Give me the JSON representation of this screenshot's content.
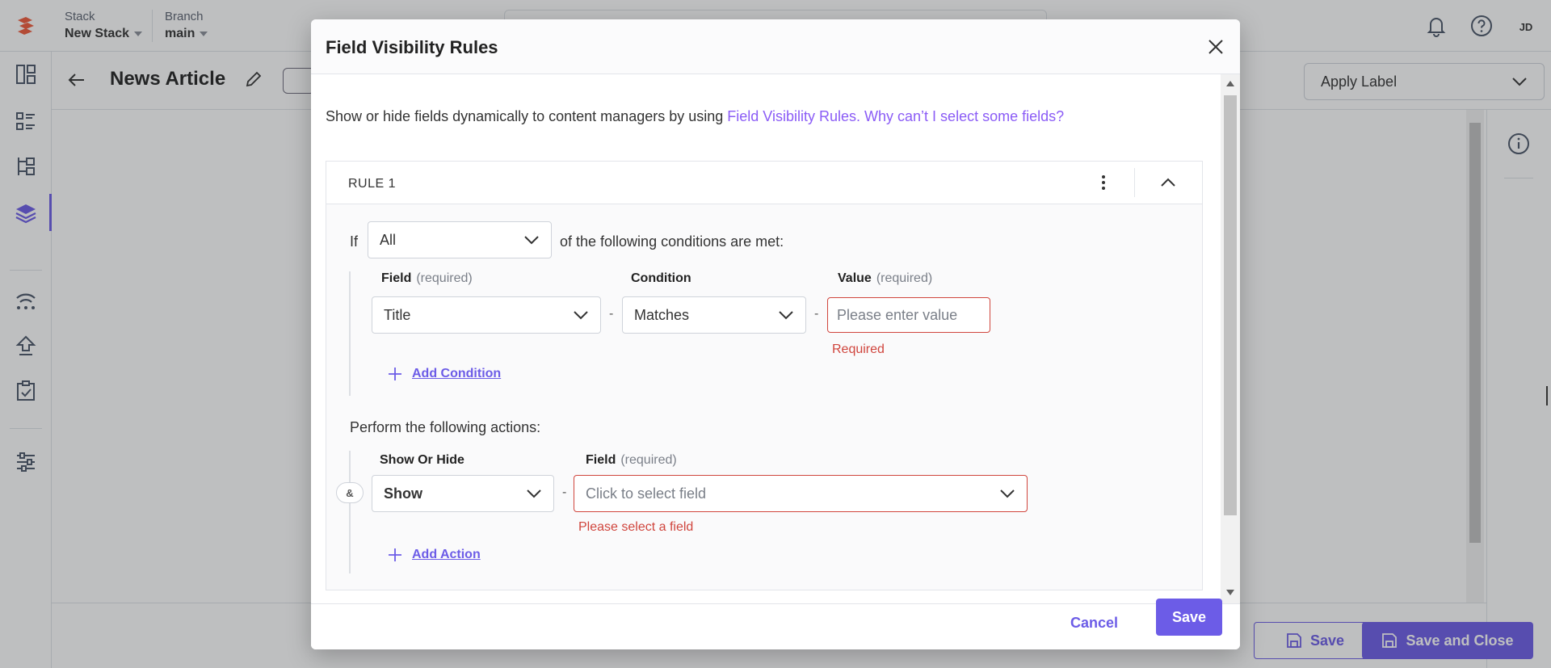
{
  "topbar": {
    "stack_label": "Stack",
    "stack_value": "New Stack",
    "branch_label": "Branch",
    "branch_value": "main",
    "avatar_initials": "JD"
  },
  "entry": {
    "title": "News Article",
    "apply_label": "Apply Label"
  },
  "bottom": {
    "save_label": "Save",
    "save_close_label": "Save and Close"
  },
  "modal": {
    "title": "Field Visibility Rules",
    "intro_text": "Show or hide fields dynamically to content managers by using ",
    "intro_link1": "Field Visibility Rules.",
    "intro_link2": "Why can’t I select some fields?",
    "rule": {
      "name": "RULE 1",
      "if_label": "If",
      "match_value": "All",
      "match_suffix": "of the following conditions are met:",
      "conditions": {
        "field_label": "Field",
        "field_req": "(required)",
        "condition_label": "Condition",
        "value_label": "Value",
        "value_req": "(required)",
        "field_value": "Title",
        "condition_value": "Matches",
        "value_placeholder": "Please enter value",
        "value_error": "Required",
        "add_condition": "Add Condition"
      },
      "actions_heading": "Perform the following actions:",
      "actions": {
        "show_hide_label": "Show Or Hide",
        "field_label": "Field",
        "field_req": "(required)",
        "show_hide_value": "Show",
        "field_placeholder": "Click to select field",
        "field_error": "Please select a field",
        "connector": "&",
        "add_action": "Add Action"
      },
      "separator": "-"
    },
    "cancel_label": "Cancel",
    "save_label": "Save"
  },
  "colors": {
    "accent": "#6c5ce7",
    "link": "#8b5cf6",
    "error": "#d0453d"
  }
}
